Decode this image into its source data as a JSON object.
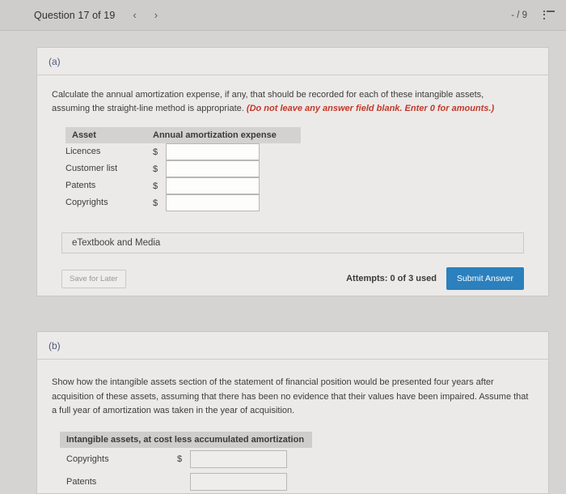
{
  "topbar": {
    "question_title": "Question 17 of 19",
    "prev_arrow": "‹",
    "next_arrow": "›",
    "score": "- / 9",
    "menu_icon_name": "list-icon"
  },
  "part_a": {
    "label": "(a)",
    "prompt_main": "Calculate the annual amortization expense, if any, that should be recorded for each of these intangible assets, assuming the straight-line method is appropriate. ",
    "prompt_emphasis": "(Do not leave any answer field blank. Enter 0 for amounts.)",
    "table": {
      "headers": [
        "Asset",
        "Annual amortization expense"
      ],
      "currency_symbol": "$",
      "rows": [
        {
          "asset": "Licences",
          "value": ""
        },
        {
          "asset": "Customer list",
          "value": ""
        },
        {
          "asset": "Patents",
          "value": ""
        },
        {
          "asset": "Copyrights",
          "value": ""
        }
      ]
    },
    "etextbook_label": "eTextbook and Media",
    "save_label": "Save for Later",
    "attempts_label": "Attempts: 0 of 3 used",
    "submit_label": "Submit Answer"
  },
  "part_b": {
    "label": "(b)",
    "prompt": "Show how the intangible assets section of the statement of financial position would be presented four years after acquisition of these assets, assuming that there has been no evidence that their values have been impaired. Assume that a full year of amortization was taken in the year of acquisition.",
    "table": {
      "header": "Intangible assets, at cost less accumulated amortization",
      "currency_symbol": "$",
      "rows": [
        {
          "asset": "Copyrights",
          "value": "",
          "show_currency": true
        },
        {
          "asset": "Patents",
          "value": "",
          "show_currency": false
        }
      ]
    }
  },
  "colors": {
    "page_background": "#d6d4d2",
    "card_background": "#eceae8",
    "accent_blue": "#2b80bd",
    "emphasis_red": "#c0392b",
    "part_label_blue": "#4c5a7a"
  }
}
